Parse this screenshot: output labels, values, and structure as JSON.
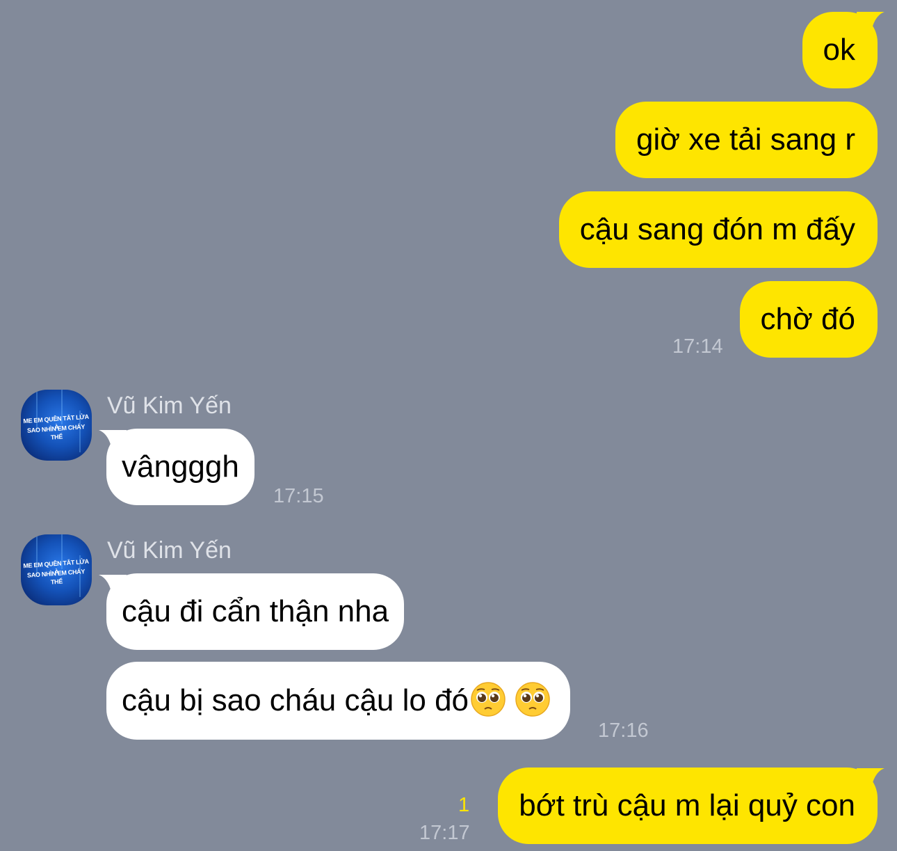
{
  "colors": {
    "background": "#828a9a",
    "outgoing_bubble": "#fee500",
    "incoming_bubble": "#ffffff",
    "timestamp": "#c3c8d2",
    "unread_count": "#fee500"
  },
  "messages_outgoing_1": [
    {
      "text": "ok"
    },
    {
      "text": "giờ xe tải sang r"
    },
    {
      "text": "cậu sang đón m đấy"
    },
    {
      "text": "chờ đó"
    }
  ],
  "time_outgoing_1": "17:14",
  "group_1": {
    "sender": "Vũ Kim Yến",
    "avatar_text": [
      "ME EM QUÊN TẮT LỬA À",
      "SAO NHÌN EM CHÁY THẾ"
    ],
    "messages": [
      {
        "text": "vângggh"
      }
    ],
    "time": "17:15"
  },
  "group_2": {
    "sender": "Vũ Kim Yến",
    "avatar_text": [
      "ME EM QUÊN TẮT LỬA À",
      "SAO NHÌN EM CHÁY THẾ"
    ],
    "messages": [
      {
        "text": "cậu đi cẩn thận nha"
      },
      {
        "text": "cậu bị sao cháu cậu lo đó",
        "emoji": "pleading-face-emoji"
      }
    ],
    "time": "17:16"
  },
  "last_outgoing": {
    "text": "bớt trù cậu m lại quỷ con",
    "unread": "1",
    "time": "17:17"
  }
}
